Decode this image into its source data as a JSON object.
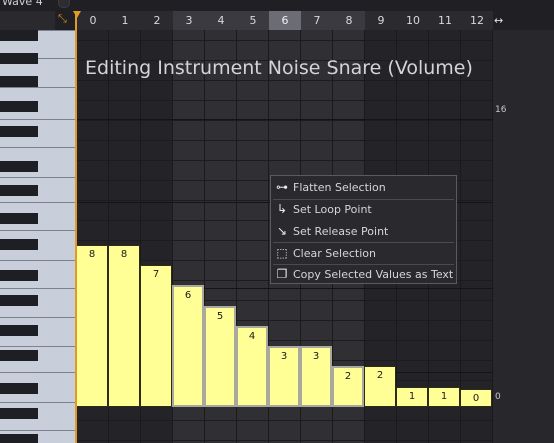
{
  "header": {
    "wave_label": "Wave 4",
    "columns": [
      "0",
      "1",
      "2",
      "3",
      "4",
      "5",
      "6",
      "7",
      "8",
      "9",
      "10",
      "11",
      "12"
    ],
    "selected_columns": [
      3,
      4,
      5,
      6,
      7,
      8
    ],
    "highlighted_column": 6,
    "resize_icon": "horizontal-resize-icon"
  },
  "editor": {
    "title": "Editing Instrument Noise Snare (Volume)",
    "scale_max": "16",
    "scale_min": "0",
    "values": [
      8,
      8,
      7,
      6,
      5,
      4,
      3,
      3,
      2,
      2,
      1,
      1,
      0
    ],
    "value_range": [
      0,
      16
    ]
  },
  "context_menu": {
    "items": [
      {
        "icon": "flatten-icon",
        "glyph": "⊶",
        "label": "Flatten Selection"
      },
      {
        "icon": "loop-point-icon",
        "glyph": "↳",
        "label": "Set Loop Point"
      },
      {
        "icon": "release-point-icon",
        "glyph": "↘",
        "label": "Set Release Point"
      },
      {
        "icon": "clear-selection-icon",
        "glyph": "⬚",
        "label": "Clear Selection"
      },
      {
        "icon": "copy-icon",
        "glyph": "❐",
        "label": "Copy Selected Values as Text"
      }
    ]
  },
  "colors": {
    "bar": "#ffff96",
    "playhead": "#e39a22",
    "background": "#242428",
    "selection_column": "#3a3a40"
  }
}
